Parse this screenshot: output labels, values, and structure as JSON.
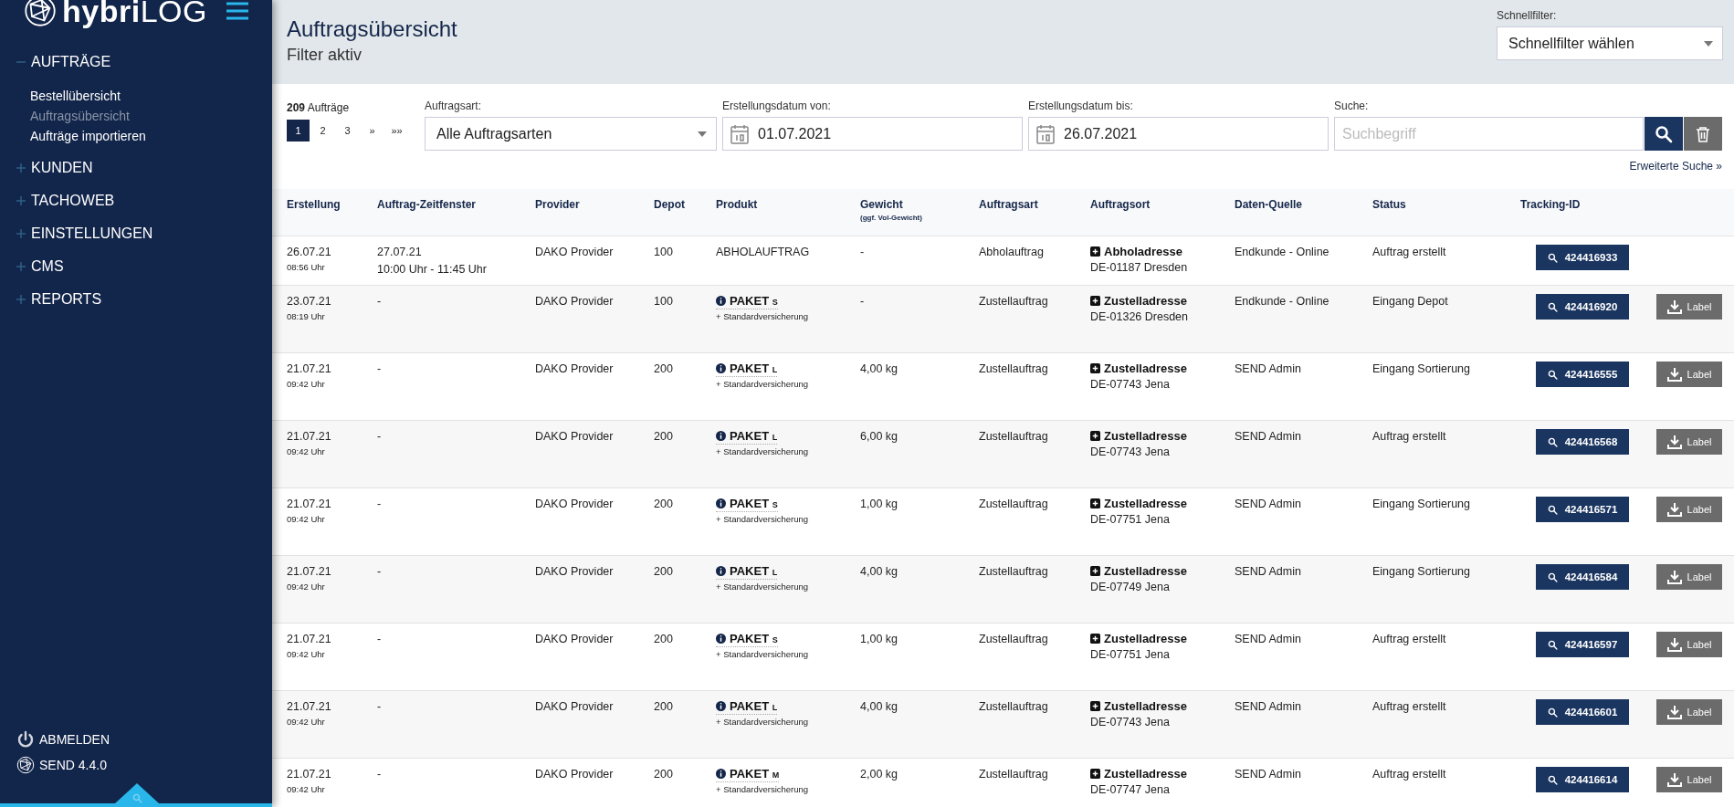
{
  "sidebar": {
    "logo": "**hybri**LOG",
    "nav": [
      {
        "label": "AUFTRÄGE",
        "expanded": true,
        "children": [
          {
            "label": "Bestellübersicht",
            "selected": false
          },
          {
            "label": "Auftragsübersicht",
            "selected": true
          },
          {
            "label": "Aufträge importieren",
            "selected": false
          }
        ]
      },
      {
        "label": "KUNDEN",
        "expanded": false
      },
      {
        "label": "TACHOWEB",
        "expanded": false
      },
      {
        "label": "EINSTELLUNGEN",
        "expanded": false
      },
      {
        "label": "CMS",
        "expanded": false
      },
      {
        "label": "REPORTS",
        "expanded": false
      }
    ],
    "logout": "ABMELDEN",
    "version": "SEND 4.4.0"
  },
  "header": {
    "title": "Auftragsübersicht",
    "subtitle": "Filter aktiv",
    "quickfilter": {
      "label": "Schnellfilter:",
      "value": "Schnellfilter wählen"
    }
  },
  "filters": {
    "count": "209",
    "count_label": "Aufträge",
    "pagination": [
      {
        "label": "1",
        "selected": true
      },
      {
        "label": "2",
        "selected": false
      },
      {
        "label": "3",
        "selected": false
      },
      {
        "label": "»",
        "selected": false
      },
      {
        "label": "»»",
        "selected": false
      }
    ],
    "order_type": {
      "label": "Auftragsart:",
      "value": "Alle Auftragsarten"
    },
    "date_from": {
      "label": "Erstellungsdatum von:",
      "value": "01.07.2021"
    },
    "date_to": {
      "label": "Erstellungsdatum bis:",
      "value": "26.07.2021"
    },
    "search": {
      "label": "Suche:",
      "placeholder": "Suchbegriff"
    },
    "advanced_link": "Erweiterte Suche »"
  },
  "table": {
    "columns": [
      {
        "label": "Erstellung"
      },
      {
        "label": "Auftrag-Zeitfenster"
      },
      {
        "label": "Provider"
      },
      {
        "label": "Depot"
      },
      {
        "label": "Produkt"
      },
      {
        "label": "Gewicht",
        "sub": "(ggf. Vol-Gewicht)"
      },
      {
        "label": "Auftragsart"
      },
      {
        "label": "Auftragsort"
      },
      {
        "label": "Daten-Quelle"
      },
      {
        "label": "Status"
      },
      {
        "label": "Tracking-ID"
      }
    ],
    "rows": [
      {
        "date": "26.07.21",
        "time": "08:56 Uhr",
        "window": [
          "27.07.21",
          "10:00 Uhr - 11:45 Uhr"
        ],
        "provider": "DAKO Provider",
        "depot": "100",
        "product": {
          "kind": "plain",
          "name": "ABHOLAUFTRAG"
        },
        "weight": "-",
        "order_type": "Abholauftrag",
        "location": {
          "type": "Abholadresse",
          "place": "DE-01187 Dresden"
        },
        "source": "Endkunde - Online",
        "status": "Auftrag erstellt",
        "tracking": "424416933"
      },
      {
        "date": "23.07.21",
        "time": "08:19 Uhr",
        "window": [
          "-"
        ],
        "provider": "DAKO Provider",
        "depot": "100",
        "product": {
          "kind": "package",
          "name": "PAKET",
          "size": "S",
          "addon": "+ Standardversicherung"
        },
        "weight": "-",
        "order_type": "Zustellauftrag",
        "location": {
          "type": "Zustelladresse",
          "place": "DE-01326 Dresden"
        },
        "source": "Endkunde - Online",
        "status": "Eingang Depot",
        "tracking": "424416920",
        "label_button": "Label"
      },
      {
        "date": "21.07.21",
        "time": "09:42 Uhr",
        "window": [
          "-"
        ],
        "provider": "DAKO Provider",
        "depot": "200",
        "product": {
          "kind": "package",
          "name": "PAKET",
          "size": "L",
          "addon": "+ Standardversicherung"
        },
        "weight": "4,00 kg",
        "order_type": "Zustellauftrag",
        "location": {
          "type": "Zustelladresse",
          "place": "DE-07743 Jena"
        },
        "source": "SEND Admin",
        "status": "Eingang Sortierung",
        "tracking": "424416555",
        "label_button": "Label"
      },
      {
        "date": "21.07.21",
        "time": "09:42 Uhr",
        "window": [
          "-"
        ],
        "provider": "DAKO Provider",
        "depot": "200",
        "product": {
          "kind": "package",
          "name": "PAKET",
          "size": "L",
          "addon": "+ Standardversicherung"
        },
        "weight": "6,00 kg",
        "order_type": "Zustellauftrag",
        "location": {
          "type": "Zustelladresse",
          "place": "DE-07743 Jena"
        },
        "source": "SEND Admin",
        "status": "Auftrag erstellt",
        "tracking": "424416568",
        "label_button": "Label"
      },
      {
        "date": "21.07.21",
        "time": "09:42 Uhr",
        "window": [
          "-"
        ],
        "provider": "DAKO Provider",
        "depot": "200",
        "product": {
          "kind": "package",
          "name": "PAKET",
          "size": "S",
          "addon": "+ Standardversicherung"
        },
        "weight": "1,00 kg",
        "order_type": "Zustellauftrag",
        "location": {
          "type": "Zustelladresse",
          "place": "DE-07751 Jena"
        },
        "source": "SEND Admin",
        "status": "Eingang Sortierung",
        "tracking": "424416571",
        "label_button": "Label"
      },
      {
        "date": "21.07.21",
        "time": "09:42 Uhr",
        "window": [
          "-"
        ],
        "provider": "DAKO Provider",
        "depot": "200",
        "product": {
          "kind": "package",
          "name": "PAKET",
          "size": "L",
          "addon": "+ Standardversicherung"
        },
        "weight": "4,00 kg",
        "order_type": "Zustellauftrag",
        "location": {
          "type": "Zustelladresse",
          "place": "DE-07749 Jena"
        },
        "source": "SEND Admin",
        "status": "Eingang Sortierung",
        "tracking": "424416584",
        "label_button": "Label"
      },
      {
        "date": "21.07.21",
        "time": "09:42 Uhr",
        "window": [
          "-"
        ],
        "provider": "DAKO Provider",
        "depot": "200",
        "product": {
          "kind": "package",
          "name": "PAKET",
          "size": "S",
          "addon": "+ Standardversicherung"
        },
        "weight": "1,00 kg",
        "order_type": "Zustellauftrag",
        "location": {
          "type": "Zustelladresse",
          "place": "DE-07751 Jena"
        },
        "source": "SEND Admin",
        "status": "Auftrag erstellt",
        "tracking": "424416597",
        "label_button": "Label"
      },
      {
        "date": "21.07.21",
        "time": "09:42 Uhr",
        "window": [
          "-"
        ],
        "provider": "DAKO Provider",
        "depot": "200",
        "product": {
          "kind": "package",
          "name": "PAKET",
          "size": "L",
          "addon": "+ Standardversicherung"
        },
        "weight": "4,00 kg",
        "order_type": "Zustellauftrag",
        "location": {
          "type": "Zustelladresse",
          "place": "DE-07743 Jena"
        },
        "source": "SEND Admin",
        "status": "Auftrag erstellt",
        "tracking": "424416601",
        "label_button": "Label"
      },
      {
        "date": "21.07.21",
        "time": "09:42 Uhr",
        "window": [
          "-"
        ],
        "provider": "DAKO Provider",
        "depot": "200",
        "product": {
          "kind": "package",
          "name": "PAKET",
          "size": "M",
          "addon": "+ Standardversicherung"
        },
        "weight": "2,00 kg",
        "order_type": "Zustellauftrag",
        "location": {
          "type": "Zustelladresse",
          "place": "DE-07747 Jena"
        },
        "source": "SEND Admin",
        "status": "Auftrag erstellt",
        "tracking": "424416614",
        "label_button": "Label"
      }
    ]
  }
}
